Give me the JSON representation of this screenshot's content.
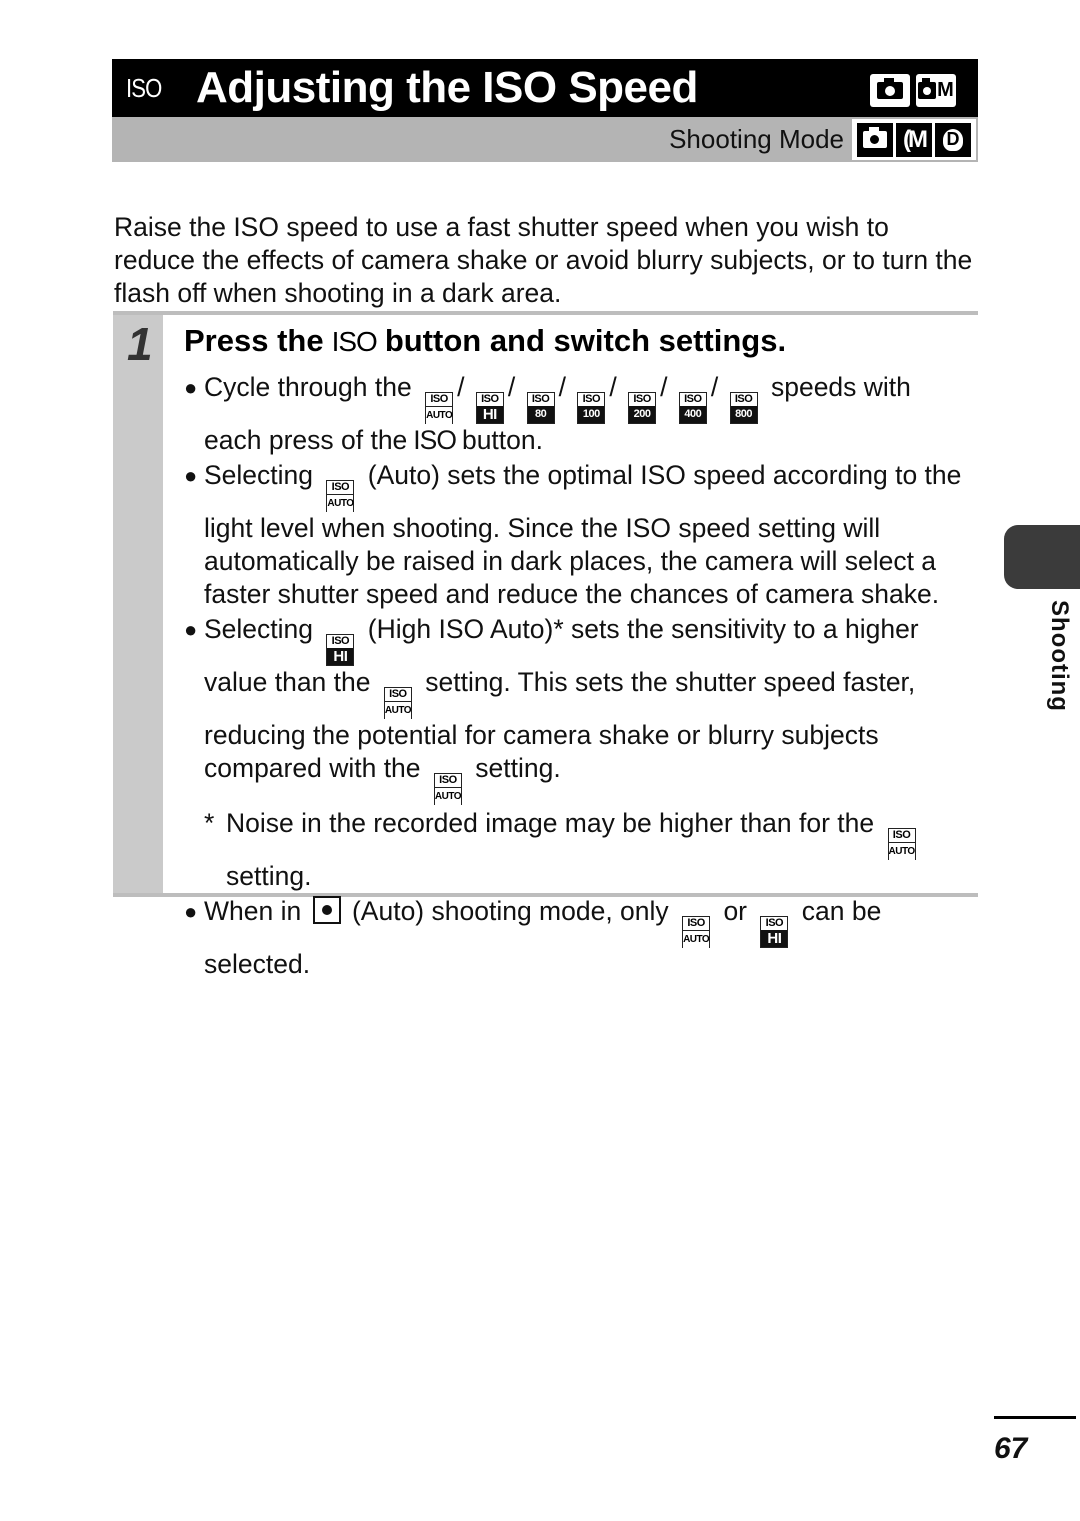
{
  "header": {
    "iso_label": "ISO",
    "title": "Adjusting the ISO Speed",
    "title_mode_icons": [
      "auto-mode-icon",
      "manual-mode-icon"
    ],
    "shooting_mode_label": "Shooting Mode",
    "shooting_mode_icons": [
      "auto-mode-icon",
      "camera-m-mode-icon",
      "digital-macro-mode-icon"
    ],
    "manual_letter": "M",
    "cm_label": "M",
    "dm_label": "D"
  },
  "intro": "Raise the ISO speed to use a fast shutter speed when you wish to reduce the effects of camera shake or avoid blurry subjects, or to turn the flash off when shooting in a dark area.",
  "step": {
    "number": "1",
    "title_pre": "Press the",
    "title_iso": "ISO",
    "title_post": "button and switch settings.",
    "iso_icons": {
      "top": "ISO",
      "auto": "AUTO",
      "hi": "HI",
      "s80": "80",
      "s100": "100",
      "s200": "200",
      "s400": "400",
      "s800": "800"
    },
    "b1_pre": "Cycle through the",
    "b1_post": "speeds with each press of the",
    "b1_iso": "ISO",
    "b1_end": "button.",
    "b2_pre": "Selecting",
    "b2_post": "(Auto) sets the optimal ISO speed according to the light level when shooting. Since the ISO speed setting will automatically be raised in dark places, the camera will select a faster shutter speed and reduce the chances of camera shake.",
    "b3_pre": "Selecting",
    "b3_mid1": "(High ISO Auto)* sets the sensitivity to a higher value than the",
    "b3_mid2": "setting. This sets the shutter speed faster, reducing the potential for camera shake or blurry subjects compared with the",
    "b3_end": "setting.",
    "note_mark": "*",
    "note_pre": "Noise in the recorded image may be higher than for the",
    "note_end": "setting.",
    "b4_pre": "When in",
    "b4_mid": "(Auto) shooting mode, only",
    "b4_or": "or",
    "b4_end": "can be selected."
  },
  "side_tab": {
    "label": "Shooting"
  },
  "page_number": "67"
}
